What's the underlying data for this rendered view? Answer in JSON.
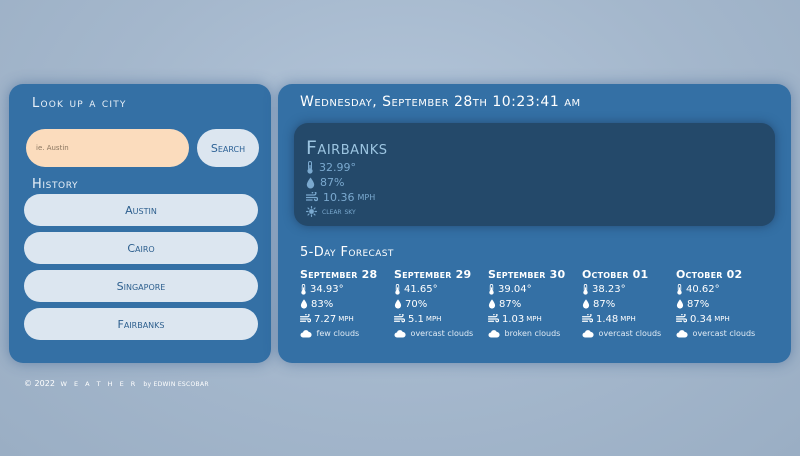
{
  "search": {
    "title": "Look up a city",
    "placeholder": "ie. Austin",
    "button_label": "Search"
  },
  "history": {
    "title": "History",
    "items": [
      "Austin",
      "Cairo",
      "Singapore",
      "Fairbanks"
    ]
  },
  "current": {
    "datetime": "Wednesday, September 28th 10:23:41 am",
    "city": "Fairbanks",
    "temp": "32.99°",
    "humidity": "87%",
    "wind": "10.36",
    "wind_unit": "MPH",
    "conditions": "clear sky",
    "icons": [
      "thermometer-icon",
      "water-drop-icon",
      "wind-icon",
      "sun-icon"
    ]
  },
  "forecast": {
    "title": "5-Day Forecast",
    "wind_unit": "MPH",
    "days": [
      {
        "date": "September 28",
        "temp": "34.93°",
        "humidity": "83%",
        "wind": "7.27",
        "desc": "few clouds"
      },
      {
        "date": "September 29",
        "temp": "41.65°",
        "humidity": "70%",
        "wind": "5.1",
        "desc": "overcast clouds"
      },
      {
        "date": "September 30",
        "temp": "39.04°",
        "humidity": "87%",
        "wind": "1.03",
        "desc": "broken clouds"
      },
      {
        "date": "October 01",
        "temp": "38.23°",
        "humidity": "87%",
        "wind": "1.48",
        "desc": "overcast clouds"
      },
      {
        "date": "October 02",
        "temp": "40.62°",
        "humidity": "87%",
        "wind": "0.34",
        "desc": "overcast clouds"
      }
    ]
  },
  "footer": {
    "copyright": "© 2022",
    "brand": "W E A T H E R",
    "author": "by EDWIN ESCOBAR"
  },
  "colors": {
    "panel": "#3470a5",
    "today_card": "#24496a",
    "input_bg": "#fbdcbd",
    "button_bg": "#dce6f0",
    "background": "#a4b7cc"
  }
}
